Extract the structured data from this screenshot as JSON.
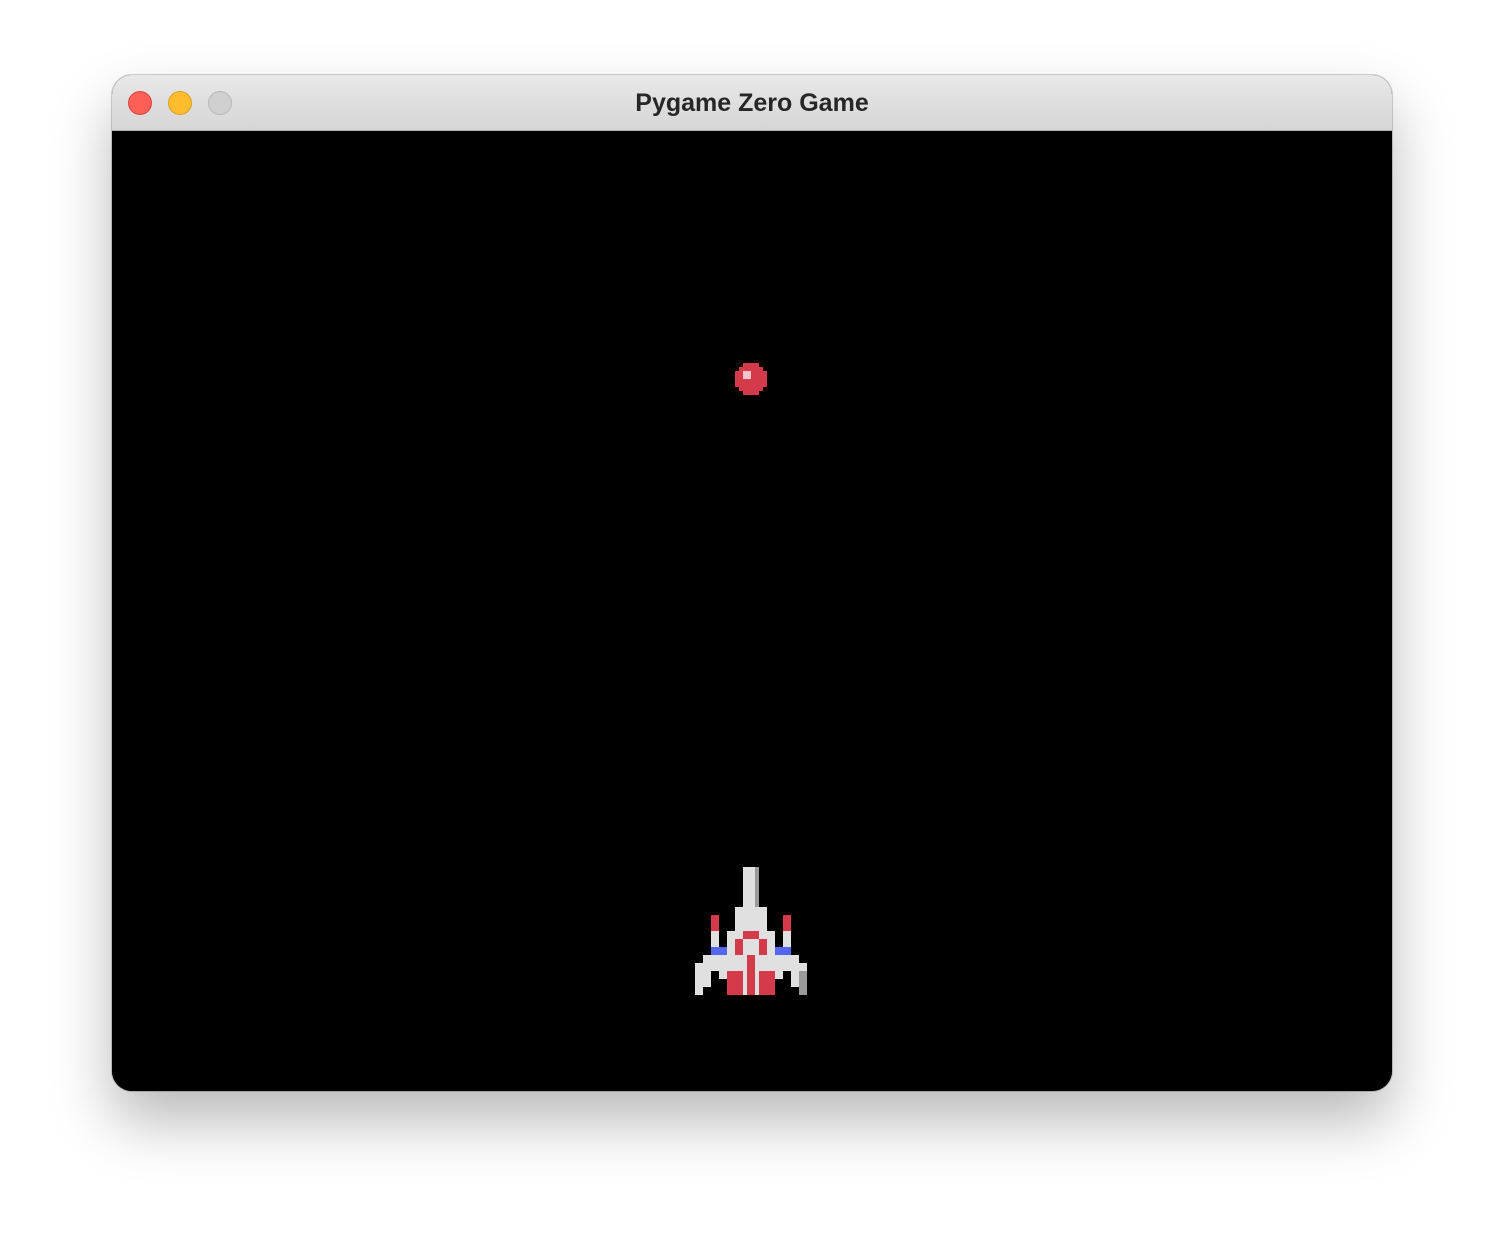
{
  "window": {
    "title": "Pygame Zero Game",
    "buttons": [
      "close",
      "minimize",
      "zoom"
    ]
  },
  "game": {
    "background_color": "#000000",
    "sprites": [
      {
        "name": "enemy-bullet",
        "icon": "red-orb-icon",
        "color": "#d43a4a"
      },
      {
        "name": "player-ship",
        "icon": "fighter-ship-icon",
        "colors": {
          "hull": "#e0e0e0",
          "accent": "#d43a4a",
          "engine": "#5566ee"
        }
      }
    ]
  }
}
